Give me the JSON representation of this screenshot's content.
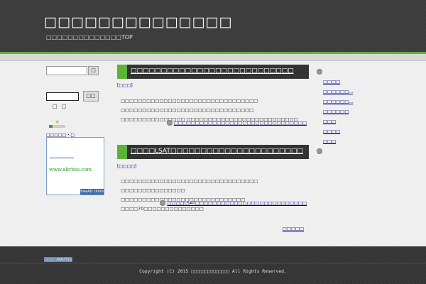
{
  "header": {
    "site_title": "□□□□□□□□□□□□□□",
    "subtitle": "□□□□□□□□□□□□□□TOP"
  },
  "sidebar": {
    "search_button": "□",
    "search2_button": "□□",
    "label": "□ □",
    "rank_link": "□□□□□・□",
    "ad": {
      "text": "www.abrbss.com",
      "badge": "freeAD.ckhm"
    }
  },
  "posts": [
    {
      "title": "□□□□□□□□□□□□□□□□□□□□□□□□□□□",
      "category": "[□□□]",
      "body": "□□□□□□□□□□□□□□□□□□□□□□□□□□□□□□□□ □□□□□□□□□□□□□□□□□□□□□□□□□□□□□□□ □□□□□□□□□□□□□□□ □□□□□□□□□□□□□□□□□□□□□□□□□□",
      "more": "□□□□□□□□□□□□□□□□□□□□□□□□□□□□□□□"
    },
    {
      "title": "□□□□LSAT□□□□□□□□□□□□□□□□□□□□□□",
      "category": "[□□□□]",
      "body": "□□□□□□□□□□□□□□□□□□□□□□□□□□□□□□□□ □□□□□□□□□□□□□□□ □□□□□□□□□□□□□□□□□□□□□□□□□□□□□ □□□□70□□□□□□□□□□□□□□",
      "more": "□□□□LSAT□□□□□□□□□□□□□□□□□□□□□□□□□□"
    }
  ],
  "prev_link": "□□□□□",
  "right_nav": [
    {
      "label": ""
    },
    {
      "label": "□□□□"
    },
    {
      "label": "□□□□□□..."
    },
    {
      "label": "□□□□□□..."
    },
    {
      "label": "□□□□□□"
    },
    {
      "label": "□□□"
    },
    {
      "label": "□□□□"
    },
    {
      "label": "□□□"
    },
    {
      "label": ""
    }
  ],
  "footer": {
    "badge": "□□□□ ANALYTICS",
    "copyright": "Copyright (C) 2015 □□□□□□□□□□□□□□ All Rights Reserved."
  }
}
